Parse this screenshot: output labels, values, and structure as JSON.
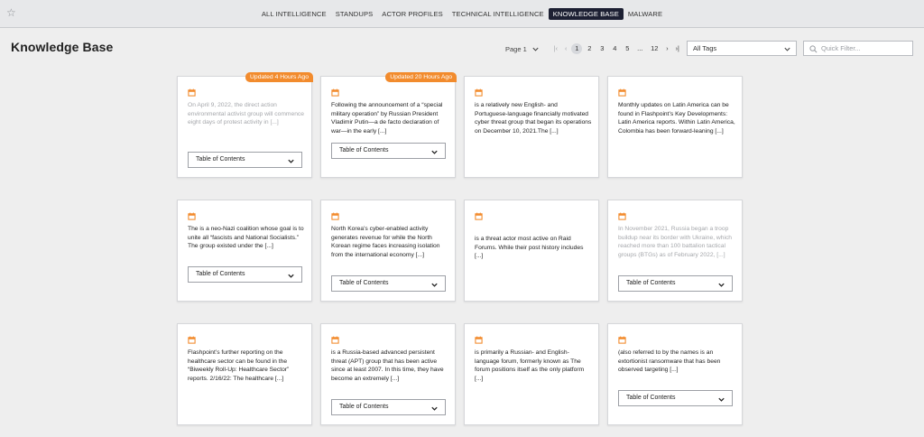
{
  "nav": {
    "tabs": [
      {
        "label": "ALL INTELLIGENCE"
      },
      {
        "label": "STANDUPS"
      },
      {
        "label": "ACTOR PROFILES"
      },
      {
        "label": "TECHNICAL INTELLIGENCE"
      },
      {
        "label": "KNOWLEDGE BASE",
        "active": true
      },
      {
        "label": "MALWARE"
      }
    ]
  },
  "page": {
    "title": "Knowledge Base"
  },
  "pagination": {
    "page_label": "Page 1",
    "first": "|‹",
    "prev": "‹",
    "pages": [
      "1",
      "2",
      "3",
      "4",
      "5"
    ],
    "ellipsis": "...",
    "last_page": "12",
    "next": "›",
    "end": "›|"
  },
  "filters": {
    "tags_selected": "All Tags",
    "quick_filter_placeholder": "Quick Filter..."
  },
  "toc_label": "Table of Contents",
  "accent_color": "#f28b2d",
  "cards": [
    {
      "badge": "Updated 4 Hours Ago",
      "text": "On April 9, 2022, the direct action environmental activist group                                         will commence eight days of protest activity in [...]",
      "faded": true
    },
    {
      "badge": "Updated 20 Hours Ago",
      "text": "Following the announcement of a “special military operation” by Russian President Vladimir Putin—a de facto declaration of war—in the early [...]",
      "faded": false
    },
    {
      "badge": "",
      "text": "                         is a relatively new English- and Portuguese-language financially motivated cyber threat group that began its operations on December 10, 2021.The [...]",
      "faded": false
    },
    {
      "badge": "",
      "text": "Monthly updates on Latin America can be found in Flashpoint’s Key Developments: Latin America reports. Within Latin America, Colombia has been forward-leaning [...]",
      "faded": false
    },
    {
      "badge": "",
      "text": "The                                    is a neo-Nazi coalition whose goal is to unite all “fascists and National Socialists.” The group existed under the [...]",
      "faded": false
    },
    {
      "badge": "",
      "text": "North Korea’s cyber-enabled activity generates revenue for                                   while the North Korean regime faces increasing isolation from the international economy [...]",
      "faded": false
    },
    {
      "badge": "",
      "text": "                                           is a threat actor most active on Raid Forums. While their post history includes [...]",
      "faded": false
    },
    {
      "badge": "",
      "text": "In November 2021, Russia began a troop buildup near its border with Ukraine, which reached more than 100 battalion tactical groups (BTGs) as of February 2022, [...]",
      "faded": true
    },
    {
      "badge": "",
      "text": "Flashpoint’s further reporting on the healthcare sector can be found in the “Biweekly Roll-Up: Healthcare Sector” reports. 2/16/22: The healthcare [...]",
      "faded": false
    },
    {
      "badge": "",
      "text": "                 is a Russia-based advanced persistent threat (APT) group that has been active since at least 2007. In this time, they have become an extremely [...]",
      "faded": false
    },
    {
      "badge": "",
      "text": "                                                          is primarily a Russian- and English-language forum, formerly known as                                   The forum positions itself as the only platform [...]",
      "faded": false
    },
    {
      "badge": "",
      "text": "             (also referred to by the names                                    is an extortionist ransomware that has been observed targeting [...]",
      "faded": false
    }
  ]
}
